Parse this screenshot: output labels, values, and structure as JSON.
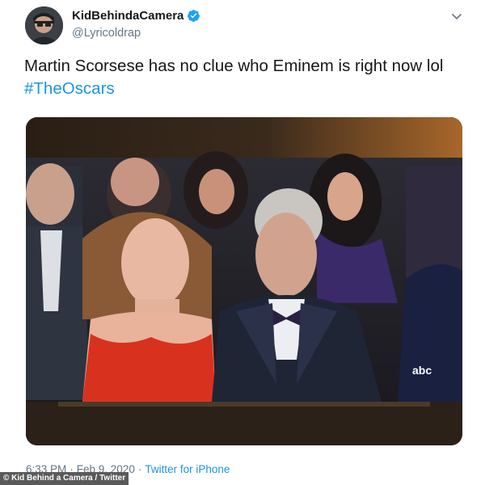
{
  "user": {
    "display_name": "KidBehindaCamera",
    "handle": "@Lyricoldrap",
    "verified": true
  },
  "tweet": {
    "text_prefix": "Martin Scorsese has no clue who Eminem is right now lol ",
    "hashtag": "#TheOscars"
  },
  "media": {
    "broadcast_logo": "abc",
    "icons": [
      "avatar",
      "verified-badge-icon",
      "chevron-down-icon"
    ]
  },
  "footer": {
    "time": "6:33 PM",
    "separator_1": "·",
    "date": "Feb 9, 2020",
    "separator_2": "·",
    "source": "Twitter for iPhone",
    "credit": "© Kid Behind a Camera / Twitter"
  },
  "colors": {
    "link": "#1b95e0",
    "secondary_text": "#657786",
    "verified": "#1da1f2"
  }
}
